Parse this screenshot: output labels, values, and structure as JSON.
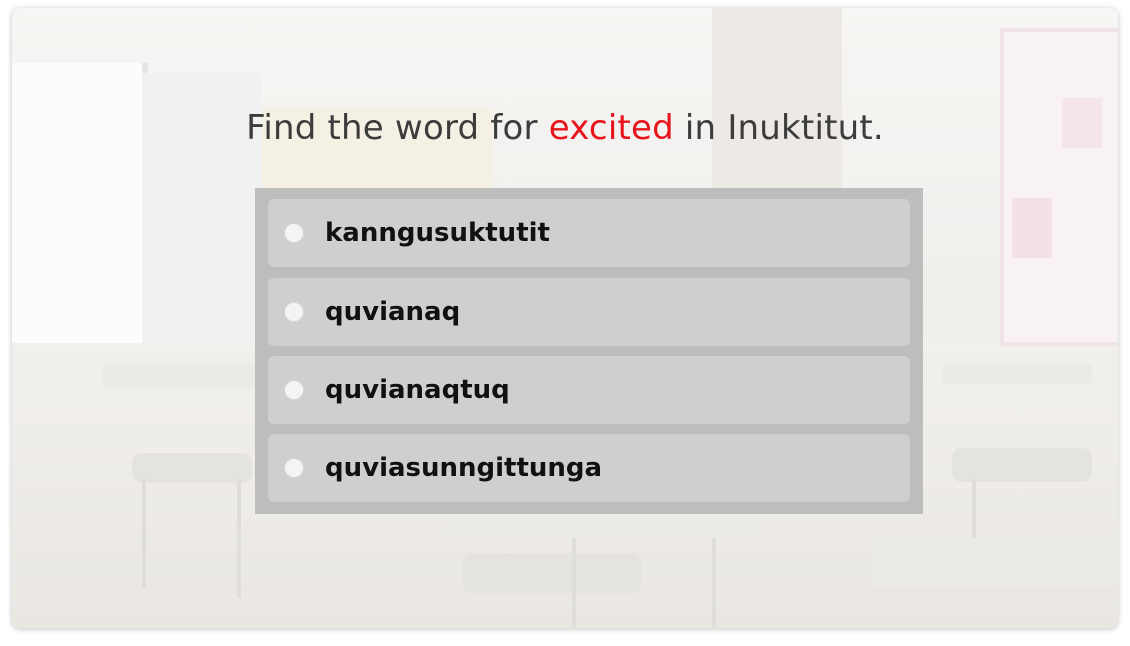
{
  "question": {
    "prefix": "Find the word for ",
    "highlight": "excited",
    "suffix": " in Inuktitut."
  },
  "options": [
    {
      "label": "kanngusuktutit",
      "selected": false
    },
    {
      "label": "quvianaq",
      "selected": false
    },
    {
      "label": "quvianaqtuq",
      "selected": false
    },
    {
      "label": "quviasunngittunga",
      "selected": false
    }
  ],
  "colors": {
    "highlight": "#e8141c",
    "question_text": "#3c3c3c",
    "options_panel": "#bdbdbd",
    "option_bg": "#cfcfcf"
  }
}
